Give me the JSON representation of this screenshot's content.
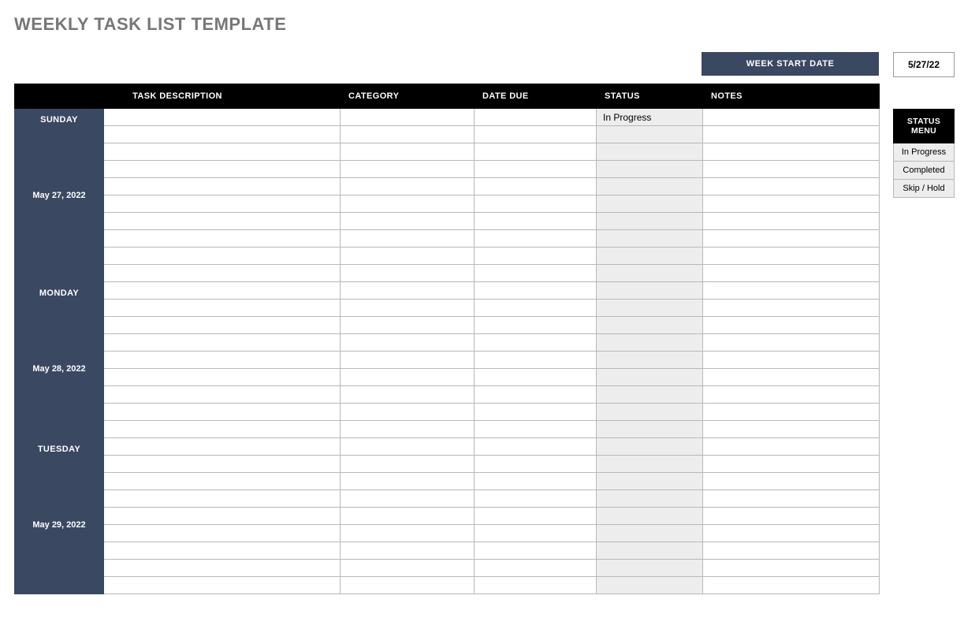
{
  "title": "WEEKLY TASK LIST TEMPLATE",
  "start_date": {
    "label": "WEEK START DATE",
    "value": "5/27/22"
  },
  "columns": {
    "desc": "TASK DESCRIPTION",
    "cat": "CATEGORY",
    "due": "DATE DUE",
    "status": "STATUS",
    "notes": "NOTES"
  },
  "days": [
    {
      "name": "SUNDAY",
      "date": "May 27, 2022",
      "rows": [
        {
          "desc": "",
          "cat": "",
          "due": "",
          "status": "In Progress",
          "notes": ""
        },
        {
          "desc": "",
          "cat": "",
          "due": "",
          "status": "",
          "notes": ""
        },
        {
          "desc": "",
          "cat": "",
          "due": "",
          "status": "",
          "notes": ""
        },
        {
          "desc": "",
          "cat": "",
          "due": "",
          "status": "",
          "notes": ""
        },
        {
          "desc": "",
          "cat": "",
          "due": "",
          "status": "",
          "notes": ""
        },
        {
          "desc": "",
          "cat": "",
          "due": "",
          "status": "",
          "notes": ""
        },
        {
          "desc": "",
          "cat": "",
          "due": "",
          "status": "",
          "notes": ""
        },
        {
          "desc": "",
          "cat": "",
          "due": "",
          "status": "",
          "notes": ""
        },
        {
          "desc": "",
          "cat": "",
          "due": "",
          "status": "",
          "notes": ""
        },
        {
          "desc": "",
          "cat": "",
          "due": "",
          "status": "",
          "notes": ""
        }
      ]
    },
    {
      "name": "MONDAY",
      "date": "May 28, 2022",
      "rows": [
        {
          "desc": "",
          "cat": "",
          "due": "",
          "status": "",
          "notes": ""
        },
        {
          "desc": "",
          "cat": "",
          "due": "",
          "status": "",
          "notes": ""
        },
        {
          "desc": "",
          "cat": "",
          "due": "",
          "status": "",
          "notes": ""
        },
        {
          "desc": "",
          "cat": "",
          "due": "",
          "status": "",
          "notes": ""
        },
        {
          "desc": "",
          "cat": "",
          "due": "",
          "status": "",
          "notes": ""
        },
        {
          "desc": "",
          "cat": "",
          "due": "",
          "status": "",
          "notes": ""
        },
        {
          "desc": "",
          "cat": "",
          "due": "",
          "status": "",
          "notes": ""
        },
        {
          "desc": "",
          "cat": "",
          "due": "",
          "status": "",
          "notes": ""
        },
        {
          "desc": "",
          "cat": "",
          "due": "",
          "status": "",
          "notes": ""
        }
      ]
    },
    {
      "name": "TUESDAY",
      "date": "May 29, 2022",
      "rows": [
        {
          "desc": "",
          "cat": "",
          "due": "",
          "status": "",
          "notes": ""
        },
        {
          "desc": "",
          "cat": "",
          "due": "",
          "status": "",
          "notes": ""
        },
        {
          "desc": "",
          "cat": "",
          "due": "",
          "status": "",
          "notes": ""
        },
        {
          "desc": "",
          "cat": "",
          "due": "",
          "status": "",
          "notes": ""
        },
        {
          "desc": "",
          "cat": "",
          "due": "",
          "status": "",
          "notes": ""
        },
        {
          "desc": "",
          "cat": "",
          "due": "",
          "status": "",
          "notes": ""
        },
        {
          "desc": "",
          "cat": "",
          "due": "",
          "status": "",
          "notes": ""
        },
        {
          "desc": "",
          "cat": "",
          "due": "",
          "status": "",
          "notes": ""
        },
        {
          "desc": "",
          "cat": "",
          "due": "",
          "status": "",
          "notes": ""
        }
      ]
    }
  ],
  "status_menu": {
    "header": "STATUS MENU",
    "items": [
      "In Progress",
      "Completed",
      "Skip / Hold"
    ]
  }
}
